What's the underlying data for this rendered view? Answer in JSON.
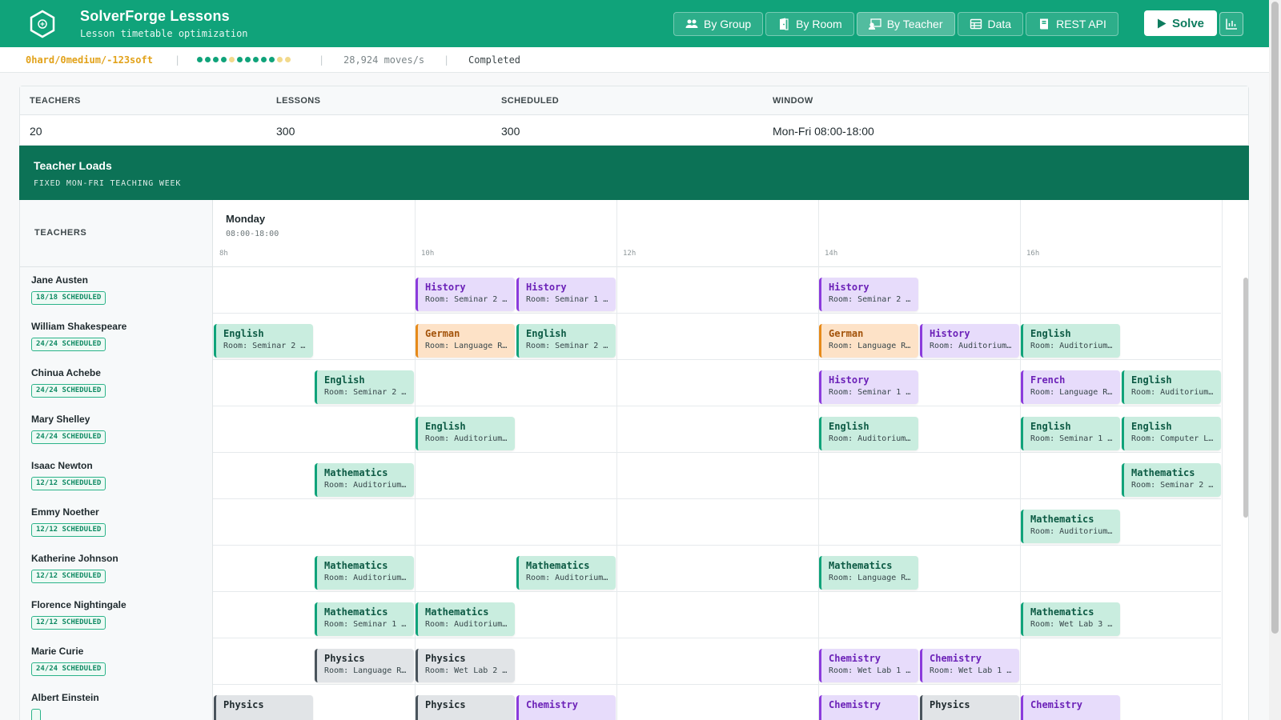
{
  "header": {
    "title": "SolverForge Lessons",
    "subtitle": "Lesson timetable optimization",
    "nav": [
      {
        "label": "By Group",
        "icon": "users-icon"
      },
      {
        "label": "By Room",
        "icon": "door-icon"
      },
      {
        "label": "By Teacher",
        "icon": "teacher-icon",
        "active": true
      },
      {
        "label": "Data",
        "icon": "table-icon"
      },
      {
        "label": "REST API",
        "icon": "book-icon"
      }
    ],
    "solve_label": "Solve"
  },
  "status": {
    "score": "0hard/0medium/-123soft",
    "dots": [
      "#10a37a",
      "#10a37a",
      "#10a37a",
      "#10a37a",
      "#f2d98b",
      "#10a37a",
      "#10a37a",
      "#10a37a",
      "#10a37a",
      "#10a37a",
      "#f2d98b",
      "#f2d98b"
    ],
    "moves": "28,924 moves/s",
    "state": "Completed"
  },
  "stats": {
    "headers": [
      "TEACHERS",
      "LESSONS",
      "SCHEDULED",
      "WINDOW"
    ],
    "values": [
      "20",
      "300",
      "300",
      "Mon-Fri 08:00-18:00"
    ]
  },
  "loads": {
    "title": "Teacher Loads",
    "subtitle": "FIXED MON-FRI TEACHING WEEK"
  },
  "grid": {
    "corner_label": "TEACHERS",
    "day": "Monday",
    "day_hours": "08:00-18:00",
    "ticks": [
      "8h",
      "10h",
      "12h",
      "14h",
      "16h"
    ],
    "teachers": [
      {
        "name": "Jane Austen",
        "badge": "18/18 SCHEDULED",
        "lessons": [
          {
            "slot": 2,
            "subject": "History",
            "room": "Room: Seminar 2 •…",
            "kind": "purple"
          },
          {
            "slot": 3,
            "subject": "History",
            "room": "Room: Seminar 1 •…",
            "kind": "purple"
          },
          {
            "slot": 6,
            "subject": "History",
            "room": "Room: Seminar 2 •…",
            "kind": "purple"
          }
        ]
      },
      {
        "name": "William Shakespeare",
        "badge": "24/24 SCHEDULED",
        "lessons": [
          {
            "slot": 0,
            "subject": "English",
            "room": "Room: Seminar 2 •…",
            "kind": "green"
          },
          {
            "slot": 2,
            "subject": "German",
            "room": "Room: Language Ro…",
            "kind": "orange"
          },
          {
            "slot": 3,
            "subject": "English",
            "room": "Room: Seminar 2 •…",
            "kind": "green"
          },
          {
            "slot": 6,
            "subject": "German",
            "room": "Room: Language Ro…",
            "kind": "orange"
          },
          {
            "slot": 7,
            "subject": "History",
            "room": "Room: Auditorium …",
            "kind": "purple"
          },
          {
            "slot": 8,
            "subject": "English",
            "room": "Room: Auditorium …",
            "kind": "green"
          }
        ]
      },
      {
        "name": "Chinua Achebe",
        "badge": "24/24 SCHEDULED",
        "lessons": [
          {
            "slot": 1,
            "subject": "English",
            "room": "Room: Seminar 2 •…",
            "kind": "green"
          },
          {
            "slot": 6,
            "subject": "History",
            "room": "Room: Seminar 1 •…",
            "kind": "purple"
          },
          {
            "slot": 8,
            "subject": "French",
            "room": "Room: Language Ro…",
            "kind": "purple"
          },
          {
            "slot": 9,
            "subject": "English",
            "room": "Room: Auditorium …",
            "kind": "green"
          }
        ]
      },
      {
        "name": "Mary Shelley",
        "badge": "24/24 SCHEDULED",
        "lessons": [
          {
            "slot": 2,
            "subject": "English",
            "room": "Room: Auditorium …",
            "kind": "green"
          },
          {
            "slot": 6,
            "subject": "English",
            "room": "Room: Auditorium …",
            "kind": "green"
          },
          {
            "slot": 8,
            "subject": "English",
            "room": "Room: Seminar 1 •…",
            "kind": "green"
          },
          {
            "slot": 9,
            "subject": "English",
            "room": "Room: Computer La…",
            "kind": "green"
          }
        ]
      },
      {
        "name": "Isaac Newton",
        "badge": "12/12 SCHEDULED",
        "lessons": [
          {
            "slot": 1,
            "subject": "Mathematics",
            "room": "Room: Auditorium …",
            "kind": "green"
          },
          {
            "slot": 9,
            "subject": "Mathematics",
            "room": "Room: Seminar 2 •…",
            "kind": "green"
          }
        ]
      },
      {
        "name": "Emmy Noether",
        "badge": "12/12 SCHEDULED",
        "lessons": [
          {
            "slot": 8,
            "subject": "Mathematics",
            "room": "Room: Auditorium …",
            "kind": "green"
          }
        ]
      },
      {
        "name": "Katherine Johnson",
        "badge": "12/12 SCHEDULED",
        "lessons": [
          {
            "slot": 1,
            "subject": "Mathematics",
            "room": "Room: Auditorium …",
            "kind": "green"
          },
          {
            "slot": 3,
            "subject": "Mathematics",
            "room": "Room: Auditorium …",
            "kind": "green"
          },
          {
            "slot": 6,
            "subject": "Mathematics",
            "room": "Room: Language Ro…",
            "kind": "green"
          }
        ]
      },
      {
        "name": "Florence Nightingale",
        "badge": "12/12 SCHEDULED",
        "lessons": [
          {
            "slot": 1,
            "subject": "Mathematics",
            "room": "Room: Seminar 1 •…",
            "kind": "green"
          },
          {
            "slot": 2,
            "subject": "Mathematics",
            "room": "Room: Auditorium …",
            "kind": "green"
          },
          {
            "slot": 8,
            "subject": "Mathematics",
            "room": "Room: Wet Lab 3 •…",
            "kind": "green"
          }
        ]
      },
      {
        "name": "Marie Curie",
        "badge": "24/24 SCHEDULED",
        "lessons": [
          {
            "slot": 1,
            "subject": "Physics",
            "room": "Room: Language Ro…",
            "kind": "gray"
          },
          {
            "slot": 2,
            "subject": "Physics",
            "room": "Room: Wet Lab 2 •…",
            "kind": "gray"
          },
          {
            "slot": 6,
            "subject": "Chemistry",
            "room": "Room: Wet Lab 1 •…",
            "kind": "purple"
          },
          {
            "slot": 7,
            "subject": "Chemistry",
            "room": "Room: Wet Lab 1 •…",
            "kind": "purple"
          }
        ]
      },
      {
        "name": "Albert Einstein",
        "badge": "",
        "lessons": [
          {
            "slot": 0,
            "subject": "Physics",
            "room": "",
            "kind": "gray"
          },
          {
            "slot": 2,
            "subject": "Physics",
            "room": "",
            "kind": "gray"
          },
          {
            "slot": 3,
            "subject": "Chemistry",
            "room": "",
            "kind": "purple"
          },
          {
            "slot": 6,
            "subject": "Chemistry",
            "room": "",
            "kind": "purple"
          },
          {
            "slot": 7,
            "subject": "Physics",
            "room": "",
            "kind": "gray"
          },
          {
            "slot": 8,
            "subject": "Chemistry",
            "room": "",
            "kind": "purple"
          }
        ]
      }
    ]
  },
  "colors": {
    "green": {
      "bg": "#c9eddf",
      "border": "#10a37a",
      "text": "#0c5a44"
    },
    "purple": {
      "bg": "#e7dcfb",
      "border": "#8b3bdc",
      "text": "#6c22b8"
    },
    "orange": {
      "bg": "#fde2c7",
      "border": "#e68a1a",
      "text": "#a3530a"
    },
    "gray": {
      "bg": "#e1e4e7",
      "border": "#4a545c",
      "text": "#1f2a2e"
    }
  }
}
